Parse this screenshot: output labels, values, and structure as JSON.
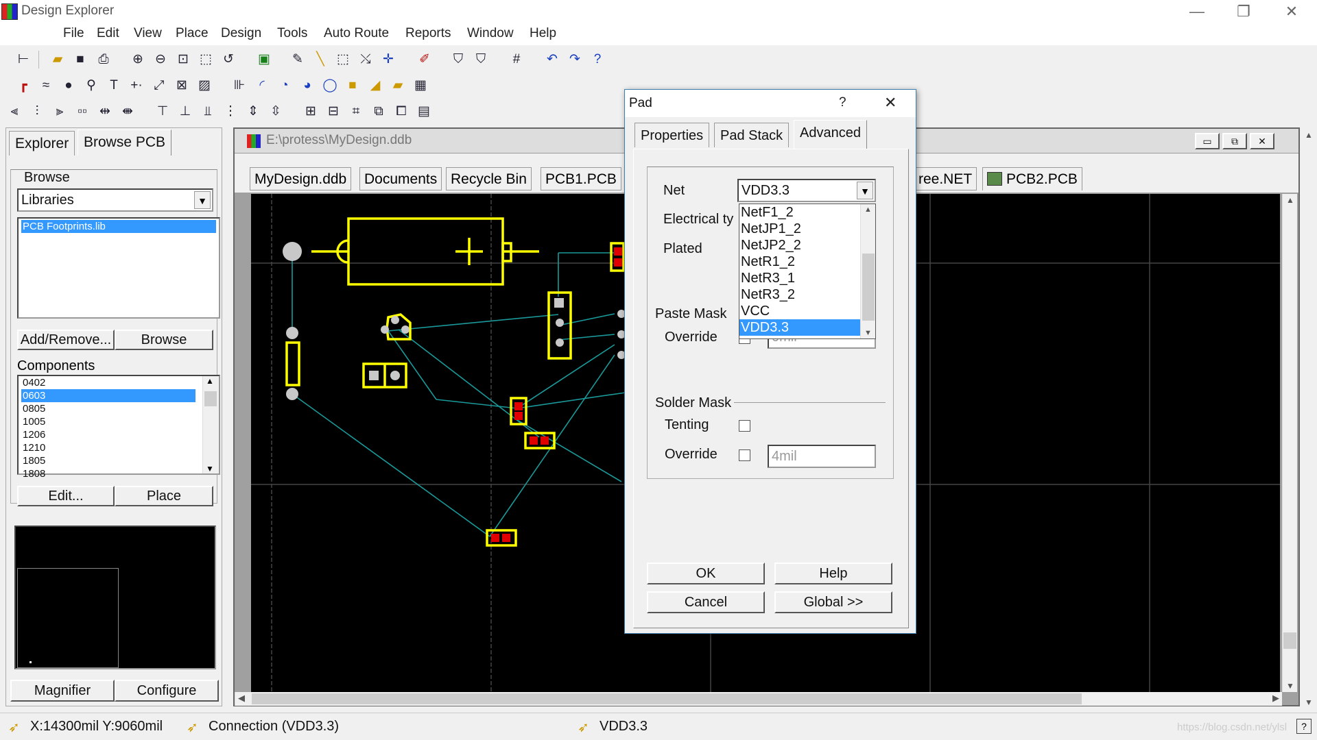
{
  "app": {
    "title": "Design Explorer",
    "minimize": "—",
    "restore": "❐",
    "close": "✕"
  },
  "menu": [
    "File",
    "Edit",
    "View",
    "Place",
    "Design",
    "Tools",
    "Auto Route",
    "Reports",
    "Window",
    "Help"
  ],
  "left_panel": {
    "tabs": [
      "Explorer",
      "Browse PCB"
    ],
    "browse_label": "Browse",
    "browse_value": "Libraries",
    "library_item": "PCB Footprints.lib",
    "add_remove_button": "Add/Remove...",
    "browse_button": "Browse",
    "components_label": "Components",
    "components": [
      "0402",
      "0603",
      "0805",
      "1005",
      "1206",
      "1210",
      "1805",
      "1808"
    ],
    "selected_component": "0603",
    "edit_button": "Edit...",
    "place_button": "Place",
    "magnifier_button": "Magnifier",
    "configure_button": "Configure"
  },
  "document": {
    "path": "E:\\protess\\MyDesign.ddb",
    "tabs": [
      "MyDesign.ddb",
      "Documents",
      "Recycle Bin",
      "PCB1.PCB",
      "ree.NET",
      "PCB2.PCB"
    ]
  },
  "dialog": {
    "title": "Pad",
    "help": "?",
    "close": "✕",
    "tabs": [
      "Properties",
      "Pad Stack",
      "Advanced"
    ],
    "active_tab": "Advanced",
    "net_label": "Net",
    "net_value": "VDD3.3",
    "net_options": [
      "NetF1_2",
      "NetJP1_2",
      "NetJP2_2",
      "NetR1_2",
      "NetR3_1",
      "NetR3_2",
      "VCC",
      "VDD3.3"
    ],
    "electrical_label": "Electrical ty",
    "plated_label": "Plated",
    "paste_mask_label": "Paste Mask",
    "paste_override_label": "Override",
    "paste_override_value": "0mil",
    "solder_mask_label": "Solder Mask",
    "tenting_label": "Tenting",
    "solder_override_label": "Override",
    "solder_override_value": "4mil",
    "ok": "OK",
    "help_button": "Help",
    "cancel": "Cancel",
    "global": "Global >>"
  },
  "status": {
    "coords": "X:14300mil Y:9060mil",
    "connection": "Connection (VDD3.3)",
    "net": "VDD3.3",
    "watermark": "https://blog.csdn.net/ylsl"
  },
  "colors": {
    "pcb_bg": "#000000",
    "footprint": "#ffff00",
    "connection": "#1a9a9a",
    "selection": "#3399ff",
    "pad_red": "#e00000"
  }
}
